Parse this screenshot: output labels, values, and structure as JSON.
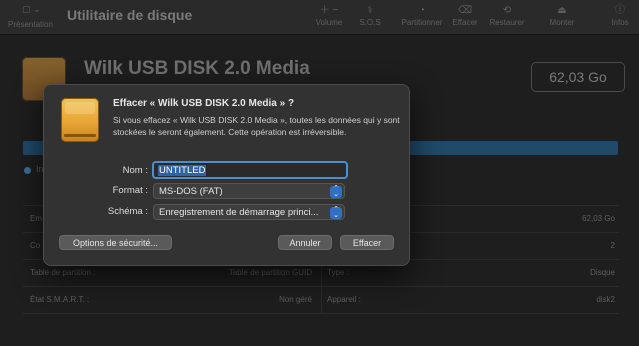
{
  "toolbar": {
    "title": "Utilitaire de disque",
    "presentation_label": "Présentation",
    "buttons": [
      {
        "label": "Volume",
        "icon": "plus-minus-icon"
      },
      {
        "label": "S.O.S",
        "icon": "stethoscope-icon"
      },
      {
        "label": "Partitionner",
        "icon": "partition-icon"
      },
      {
        "label": "Effacer",
        "icon": "erase-icon"
      },
      {
        "label": "Restaurer",
        "icon": "restore-icon"
      },
      {
        "label": "Monter",
        "icon": "mount-icon"
      },
      {
        "label": "Infos",
        "icon": "info-icon"
      }
    ]
  },
  "disk": {
    "title": "Wilk USB DISK 2.0 Media",
    "size": "62,03 Go"
  },
  "info": {
    "rows": [
      {
        "left_key": "Em",
        "left_val": "",
        "right_key": "",
        "right_val": "62,03 Go"
      },
      {
        "left_key": "Co",
        "left_val": "",
        "right_key": "",
        "right_val": "2"
      },
      {
        "left_key": "Table de partition :",
        "left_val": "Table de partition GUID",
        "right_key": "Type :",
        "right_val": "Disque"
      },
      {
        "left_key": "État S.M.A.R.T. :",
        "left_val": "Non géré",
        "right_key": "Appareil :",
        "right_val": "disk2"
      }
    ],
    "legend_label": "In"
  },
  "dialog": {
    "title": "Effacer « Wilk USB DISK 2.0 Media » ?",
    "message": "Si vous effacez « Wilk USB DISK 2.0 Media », toutes les données qui y sont stockées le seront également. Cette opération est irréversible.",
    "name_label": "Nom :",
    "name_value": "UNTITLED",
    "format_label": "Format :",
    "format_value": "MS-DOS (FAT)",
    "scheme_label": "Schéma :",
    "scheme_value": "Enregistrement de démarrage princi...",
    "security_button": "Options de sécurité...",
    "cancel_button": "Annuler",
    "erase_button": "Effacer"
  },
  "colors": {
    "accent": "#2f6fc4",
    "focus_ring": "#4a8fd0",
    "disk_orange": "#e8a636"
  }
}
